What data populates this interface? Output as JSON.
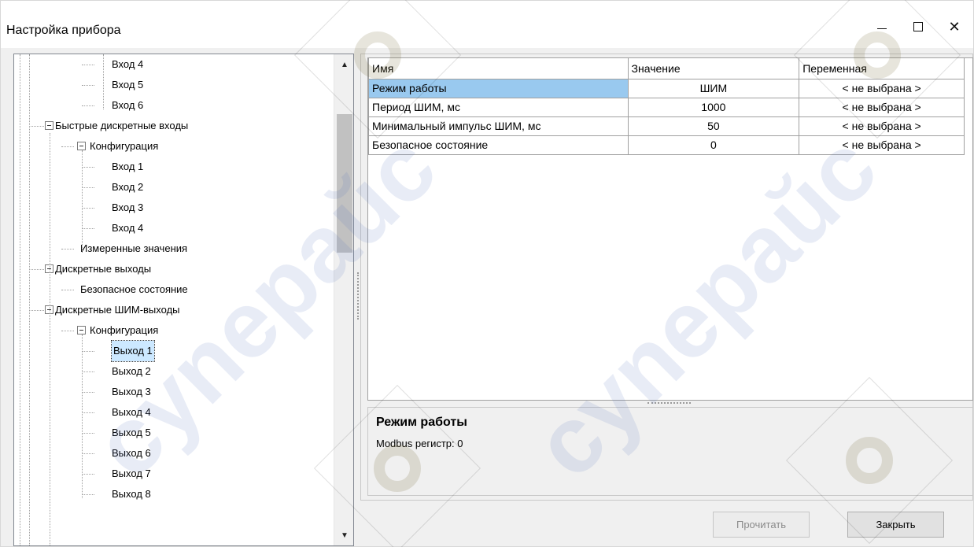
{
  "window": {
    "title": "Настройка прибора",
    "controls": {
      "minimize": "—",
      "maximize": "☐",
      "close": "✕"
    }
  },
  "tree": {
    "items": [
      {
        "label": "Вход 4",
        "level": 3,
        "expander": false
      },
      {
        "label": "Вход 5",
        "level": 3,
        "expander": false
      },
      {
        "label": "Вход 6",
        "level": 3,
        "expander": false
      },
      {
        "label": "Быстрые дискретные входы",
        "level": 1,
        "expander": true
      },
      {
        "label": "Конфигурация",
        "level": 2,
        "expander": true
      },
      {
        "label": "Вход 1",
        "level": 3,
        "expander": false
      },
      {
        "label": "Вход 2",
        "level": 3,
        "expander": false
      },
      {
        "label": "Вход 3",
        "level": 3,
        "expander": false
      },
      {
        "label": "Вход 4",
        "level": 3,
        "expander": false
      },
      {
        "label": "Измеренные значения",
        "level": 2,
        "expander": false
      },
      {
        "label": "Дискретные выходы",
        "level": 1,
        "expander": true
      },
      {
        "label": "Безопасное состояние",
        "level": 2,
        "expander": false
      },
      {
        "label": "Дискретные ШИМ-выходы",
        "level": 1,
        "expander": true
      },
      {
        "label": "Конфигурация",
        "level": 2,
        "expander": true
      },
      {
        "label": "Выход 1",
        "level": 3,
        "expander": false,
        "selected": true
      },
      {
        "label": "Выход 2",
        "level": 3,
        "expander": false
      },
      {
        "label": "Выход 3",
        "level": 3,
        "expander": false
      },
      {
        "label": "Выход 4",
        "level": 3,
        "expander": false
      },
      {
        "label": "Выход 5",
        "level": 3,
        "expander": false
      },
      {
        "label": "Выход 6",
        "level": 3,
        "expander": false
      },
      {
        "label": "Выход 7",
        "level": 3,
        "expander": false
      },
      {
        "label": "Выход 8",
        "level": 3,
        "expander": false
      }
    ],
    "scroll_up_icon": "▲",
    "scroll_down_icon": "▼"
  },
  "grid": {
    "headers": {
      "name": "Имя",
      "value": "Значение",
      "variable": "Переменная"
    },
    "rows": [
      {
        "name": "Режим работы",
        "value": "ШИМ",
        "variable": "< не выбрана >",
        "selected": true
      },
      {
        "name": "Период ШИМ, мс",
        "value": "1000",
        "variable": "< не выбрана >"
      },
      {
        "name": "Минимальный импульс ШИМ, мс",
        "value": "50",
        "variable": "< не выбрана >"
      },
      {
        "name": "Безопасное состояние",
        "value": "0",
        "variable": "< не выбрана >"
      }
    ],
    "selected_color": "#99c9ef"
  },
  "description": {
    "title": "Режим работы",
    "text": "Modbus регистр: 0"
  },
  "buttons": {
    "read": "Прочитать",
    "close": "Закрыть"
  },
  "watermark": {
    "text": "cynepaŭc"
  }
}
